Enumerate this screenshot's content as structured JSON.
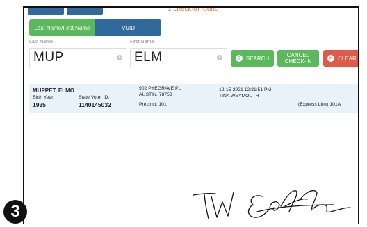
{
  "status": {
    "found_text": "1 check-in found"
  },
  "toggle": {
    "name_tab": "Last Name/First Name",
    "vuid_tab": "VUID"
  },
  "search": {
    "last_name_label": "Last Name",
    "last_name_value": "MUP",
    "first_name_label": "First Name",
    "first_name_value": "ELM"
  },
  "buttons": {
    "search_label": "SEARCH",
    "cancel_line1": "CANCEL",
    "cancel_line2": "CHECK-IN",
    "clear_label": "CLEAR"
  },
  "result": {
    "name": "MUPPET, ELMO",
    "birth_year_label": "Birth Year:",
    "birth_year": "1935",
    "state_voter_id_label": "State Voter ID:",
    "state_voter_id": "1140145032",
    "address_line1": "902 PYEGRAVE PL",
    "address_line2": "AUSTIN, 78753",
    "precinct": "Precinct: 101",
    "checkin_time": "12-15-2021 12:31:51 PM",
    "worker": "TINA WEYMOUTH",
    "express_link": "(Express Link) 101A"
  },
  "step_badge": "3",
  "colors": {
    "green": "#5cb85c",
    "blue": "#2f6a9a",
    "red": "#e05a4a",
    "orange": "#e07b3a",
    "row_bg": "#e8f2fb"
  },
  "icons": [
    "search-icon",
    "close-icon",
    "clear-field-icon"
  ]
}
